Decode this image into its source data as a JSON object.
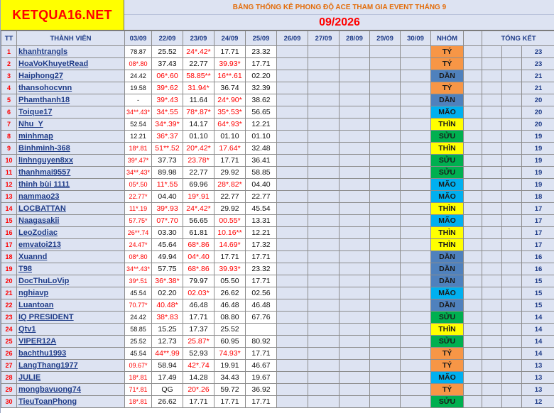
{
  "logo": "KETQUA16.NET",
  "title": "BẢNG THỐNG KÊ PHONG ĐỘ ACE THAM GIA EVENT THÁNG 9",
  "month": "09/2026",
  "headers": [
    "TT",
    "THÀNH VIÊN",
    "03/09",
    "22/09",
    "23/09",
    "24/09",
    "25/09",
    "26/09",
    "27/09",
    "28/09",
    "29/09",
    "30/09",
    "NHÓM",
    "TỔNG KẾT"
  ],
  "team_colors": {
    "TÝ": "#f79646",
    "DẦN": "#4f81bd",
    "MÃO": "#00b0f0",
    "THÌN": "#ffff00",
    "SỬU": "#00b050"
  },
  "rows": [
    {
      "tt": "1",
      "name": "khanhtrangls",
      "v0": "78.87",
      "v1": "25.52",
      "v2": "24*.42*",
      "v3": "17.71",
      "v4": "23.32",
      "r": [
        0,
        0,
        1,
        0,
        0
      ],
      "team": "TÝ",
      "total": "23"
    },
    {
      "tt": "2",
      "name": "HoaVoKhuyetRead",
      "v0": "08*.80",
      "v1": "37.43",
      "v2": "22.77",
      "v3": "39.93*",
      "v4": "17.71",
      "r": [
        1,
        0,
        0,
        1,
        0
      ],
      "team": "TÝ",
      "total": "23"
    },
    {
      "tt": "3",
      "name": "Haiphong27",
      "v0": "24.42",
      "v1": "06*.60",
      "v2": "58.85**",
      "v3": "16**.61",
      "v4": "02.20",
      "r": [
        0,
        1,
        1,
        1,
        0
      ],
      "team": "DẦN",
      "total": "21"
    },
    {
      "tt": "4",
      "name": "thansohocvnn",
      "v0": "19.58",
      "v1": "39*.62",
      "v2": "31.94*",
      "v3": "36.74",
      "v4": "32.39",
      "r": [
        0,
        1,
        1,
        0,
        0
      ],
      "team": "TÝ",
      "total": "21"
    },
    {
      "tt": "5",
      "name": "Phamthanh18",
      "v0": "-",
      "v1": "39*.43",
      "v2": "11.64",
      "v3": "24*.90*",
      "v4": "38.62",
      "r": [
        0,
        1,
        0,
        1,
        0
      ],
      "team": "DẦN",
      "total": "20"
    },
    {
      "tt": "6",
      "name": "Toique17",
      "v0": "34**.43*",
      "v1": "34*.55",
      "v2": "78*.87*",
      "v3": "35*.53*",
      "v4": "56.65",
      "r": [
        1,
        1,
        1,
        1,
        0
      ],
      "team": "MÃO",
      "total": "20"
    },
    {
      "tt": "7",
      "name": "Nhu_Y",
      "v0": "52.54",
      "v1": "34*.39*",
      "v2": "14.17",
      "v3": "64*.93*",
      "v4": "12.21",
      "r": [
        0,
        1,
        0,
        1,
        0
      ],
      "team": "THÌN",
      "total": "20"
    },
    {
      "tt": "8",
      "name": "minhmap",
      "v0": "12.21",
      "v1": "36*.37",
      "v2": "01.10",
      "v3": "01.10",
      "v4": "01.10",
      "r": [
        0,
        1,
        0,
        0,
        0
      ],
      "team": "SỬU",
      "total": "19"
    },
    {
      "tt": "9",
      "name": "Binhminh-368",
      "v0": "18*.81",
      "v1": "51**.52",
      "v2": "20*.42*",
      "v3": "17.64*",
      "v4": "32.48",
      "r": [
        1,
        1,
        1,
        1,
        0
      ],
      "team": "THÌN",
      "total": "19"
    },
    {
      "tt": "10",
      "name": "linhnguyen8xx",
      "v0": "39*.47*",
      "v1": "37.73",
      "v2": "23.78*",
      "v3": "17.71",
      "v4": "36.41",
      "r": [
        1,
        0,
        1,
        0,
        0
      ],
      "team": "SỬU",
      "total": "19"
    },
    {
      "tt": "11",
      "name": "thanhmai9557",
      "v0": "34**.43*",
      "v1": "89.98",
      "v2": "22.77",
      "v3": "29.92",
      "v4": "58.85",
      "r": [
        1,
        0,
        0,
        0,
        0
      ],
      "team": "SỬU",
      "total": "19"
    },
    {
      "tt": "12",
      "name": "thinh bùi 1111",
      "v0": "05*.50",
      "v1": "11*.55",
      "v2": "69.96",
      "v3": "28*.82*",
      "v4": "04.40",
      "r": [
        1,
        1,
        0,
        1,
        0
      ],
      "team": "MÃO",
      "total": "19"
    },
    {
      "tt": "13",
      "name": "nammao23",
      "v0": "22.77*",
      "v1": "04.40",
      "v2": "19*.91",
      "v3": "22.77",
      "v4": "22.77",
      "r": [
        1,
        0,
        1,
        0,
        0
      ],
      "team": "MÃO",
      "total": "18"
    },
    {
      "tt": "14",
      "name": "LOCBATTAN",
      "v0": "11*.19",
      "v1": "39*.93",
      "v2": "24*.42*",
      "v3": "29.92",
      "v4": "45.54",
      "r": [
        1,
        1,
        1,
        0,
        0
      ],
      "team": "THÌN",
      "total": "17"
    },
    {
      "tt": "15",
      "name": "Naagasakii",
      "v0": "57.75*",
      "v1": "07*.70",
      "v2": "56.65",
      "v3": "00.55*",
      "v4": "13.31",
      "r": [
        1,
        1,
        0,
        1,
        0
      ],
      "team": "MÃO",
      "total": "17"
    },
    {
      "tt": "16",
      "name": "LeoZodiac",
      "v0": "26**.74",
      "v1": "03.30",
      "v2": "61.81",
      "v3": "10.16**",
      "v4": "12.21",
      "r": [
        1,
        0,
        0,
        1,
        0
      ],
      "team": "THÌN",
      "total": "17"
    },
    {
      "tt": "17",
      "name": "emvatoi213",
      "v0": "24.47*",
      "v1": "45.64",
      "v2": "68*.86",
      "v3": "14.69*",
      "v4": "17.32",
      "r": [
        1,
        0,
        1,
        1,
        0
      ],
      "team": "THÌN",
      "total": "17"
    },
    {
      "tt": "18",
      "name": "Xuannd",
      "v0": "08*.80",
      "v1": "49.94",
      "v2": "04*.40",
      "v3": "17.71",
      "v4": "17.71",
      "r": [
        1,
        0,
        1,
        0,
        0
      ],
      "team": "DẦN",
      "total": "16"
    },
    {
      "tt": "19",
      "name": "T98",
      "v0": "34**.43*",
      "v1": "57.75",
      "v2": "68*.86",
      "v3": "39.93*",
      "v4": "23.32",
      "r": [
        1,
        0,
        1,
        1,
        0
      ],
      "team": "DẦN",
      "total": "16"
    },
    {
      "tt": "20",
      "name": "DocThuLoVip",
      "v0": "39*.51",
      "v1": "36*.38*",
      "v2": "79.97",
      "v3": "05.50",
      "v4": "17.71",
      "r": [
        1,
        1,
        0,
        0,
        0
      ],
      "team": "DẦN",
      "total": "15"
    },
    {
      "tt": "21",
      "name": "nghiavp",
      "v0": "45.54",
      "v1": "02.20",
      "v2": "02.03*",
      "v3": "26.62",
      "v4": "02.56",
      "r": [
        0,
        0,
        1,
        0,
        0
      ],
      "team": "MÃO",
      "total": "15"
    },
    {
      "tt": "22",
      "name": "Luantoan",
      "v0": "70.77*",
      "v1": "40.48*",
      "v2": "46.48",
      "v3": "46.48",
      "v4": "46.48",
      "r": [
        1,
        1,
        0,
        0,
        0
      ],
      "team": "DẦN",
      "total": "15"
    },
    {
      "tt": "23",
      "name": "IQ PRESIDENT",
      "v0": "24.42",
      "v1": "38*.83",
      "v2": "17.71",
      "v3": "08.80",
      "v4": "67.76",
      "r": [
        0,
        1,
        0,
        0,
        0
      ],
      "team": "SỬU",
      "total": "14"
    },
    {
      "tt": "24",
      "name": "Qtv1",
      "v0": "58.85",
      "v1": "15.25",
      "v2": "17.37",
      "v3": "25.52",
      "v4": "",
      "r": [
        0,
        0,
        0,
        0,
        0
      ],
      "team": "THÌN",
      "total": "14"
    },
    {
      "tt": "25",
      "name": "VIPER12A",
      "v0": "25.52",
      "v1": "12.73",
      "v2": "25.87*",
      "v3": "60.95",
      "v4": "80.92",
      "r": [
        0,
        0,
        1,
        0,
        0
      ],
      "team": "SỬU",
      "total": "14"
    },
    {
      "tt": "26",
      "name": "bachthu1993",
      "v0": "45.54",
      "v1": "44**.99",
      "v2": "52.93",
      "v3": "74.93*",
      "v4": "17.71",
      "r": [
        0,
        1,
        0,
        1,
        0
      ],
      "team": "TÝ",
      "total": "14"
    },
    {
      "tt": "27",
      "name": "LangThang1977",
      "v0": "09.67*",
      "v1": "58.94",
      "v2": "42*.74",
      "v3": "19.91",
      "v4": "46.67",
      "r": [
        1,
        0,
        1,
        0,
        0
      ],
      "team": "TÝ",
      "total": "13"
    },
    {
      "tt": "28",
      "name": "JULIE",
      "v0": "18*.81",
      "v1": "17.49",
      "v2": "14.28",
      "v3": "34.43",
      "v4": "19.67",
      "r": [
        1,
        0,
        0,
        0,
        0
      ],
      "team": "MÃO",
      "total": "13"
    },
    {
      "tt": "29",
      "name": "mongbavuong74",
      "v0": "71*.81",
      "v1": "QG",
      "v2": "20*.26",
      "v3": "59.72",
      "v4": "36.92",
      "r": [
        1,
        0,
        1,
        0,
        0
      ],
      "team": "TÝ",
      "total": "13"
    },
    {
      "tt": "30",
      "name": "TieuToanPhong",
      "v0": "18*.81",
      "v1": "26.62",
      "v2": "17.71",
      "v3": "17.71",
      "v4": "17.71",
      "r": [
        1,
        0,
        0,
        0,
        0
      ],
      "team": "SỬU",
      "total": "12"
    }
  ]
}
